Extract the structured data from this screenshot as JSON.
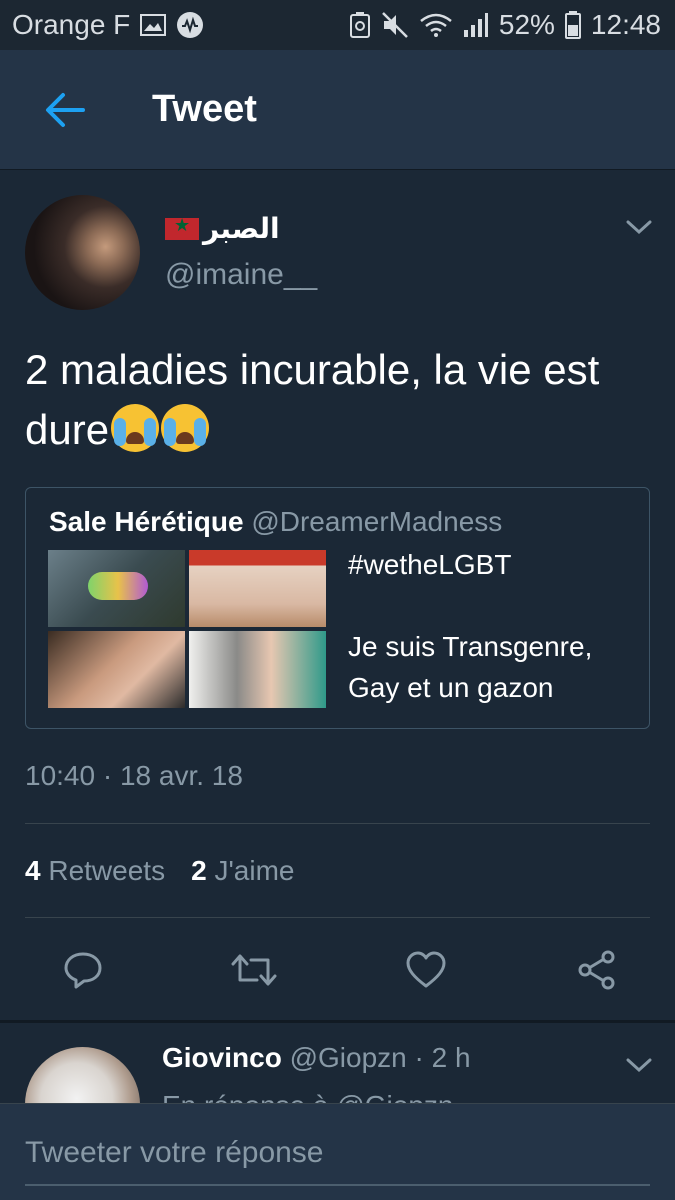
{
  "status_bar": {
    "carrier": "Orange F",
    "battery": "52%",
    "time": "12:48",
    "icons": [
      "image-icon",
      "music-app-icon",
      "battery-saver-icon",
      "mute-icon",
      "wifi-icon",
      "signal-icon",
      "battery-icon"
    ]
  },
  "header": {
    "title": "Tweet",
    "back_icon": "arrow-left-icon"
  },
  "tweet": {
    "display_name": "الصبر",
    "handle": "@imaine__",
    "text": "2 maladies incurable, la vie est dure",
    "emojis": [
      "loudly-crying-face",
      "loudly-crying-face"
    ],
    "quoted": {
      "name": "Sale Hérétique",
      "handle": "@DreamerMadness",
      "text_line1": "#wetheLGBT",
      "text_line2": "Je suis Transgenre, Gay et un gazon",
      "image_count": 4
    },
    "timestamp": "10:40 · 18 avr. 18",
    "retweets_count": "4",
    "retweets_label": "Retweets",
    "likes_count": "2",
    "likes_label": "J'aime",
    "actions": [
      "reply-icon",
      "retweet-icon",
      "like-icon",
      "share-icon"
    ]
  },
  "reply": {
    "name": "Giovinco",
    "handle": "@Giopzn",
    "time": "· 2 h",
    "partial_text": "En réponse à @Giopzn"
  },
  "composer": {
    "placeholder": "Tweeter votre réponse"
  },
  "colors": {
    "background": "#1b2836",
    "appbar": "#243447",
    "accent": "#1da1f2",
    "secondary_text": "#8899a6"
  }
}
